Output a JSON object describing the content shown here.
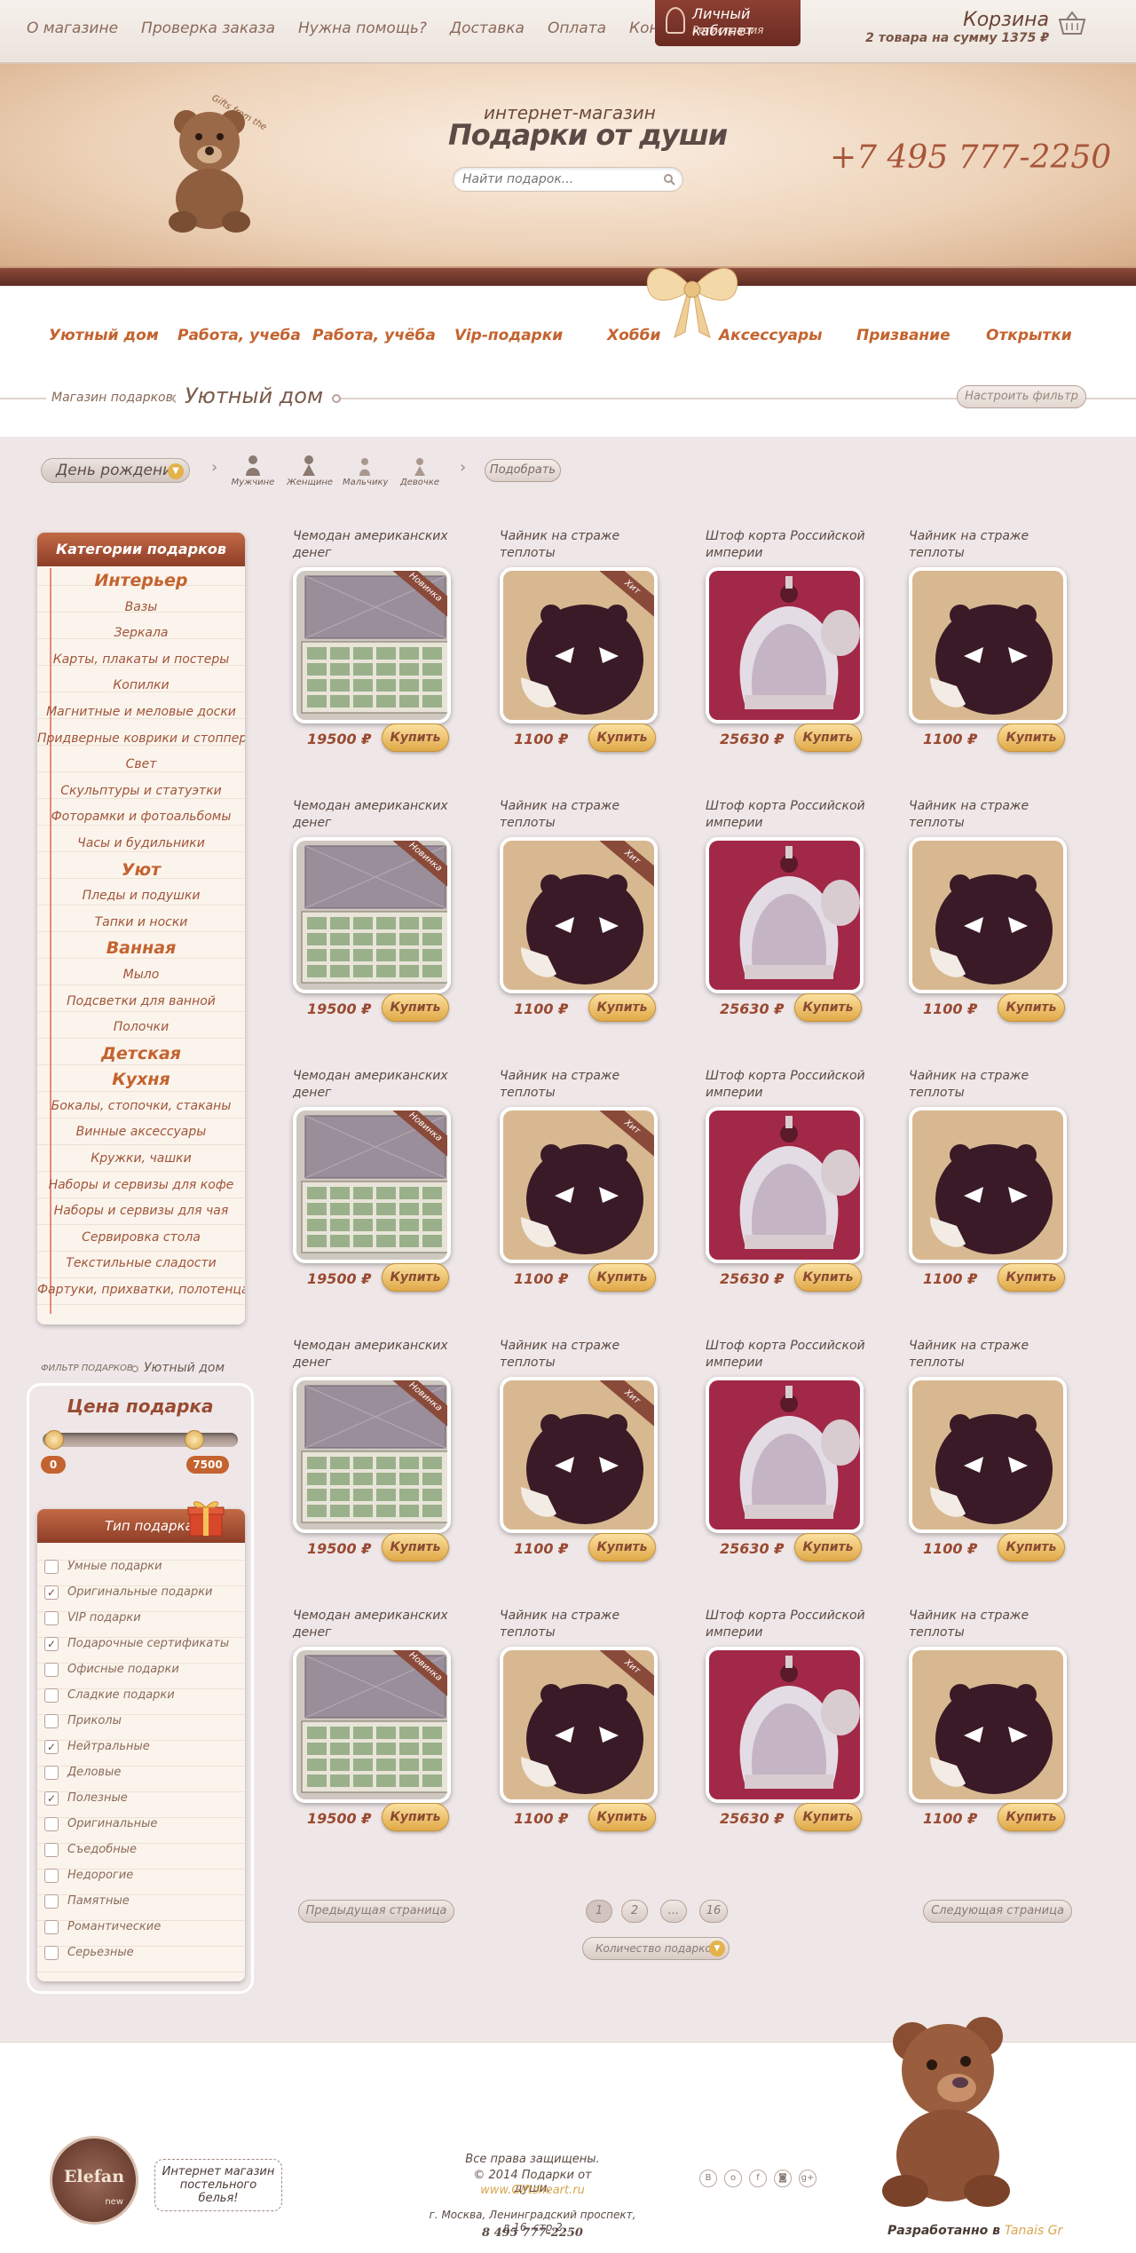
{
  "top_nav": [
    "О магазине",
    "Проверка заказа",
    "Нужна помощь?",
    "Доставка",
    "Оплата",
    "Контакты"
  ],
  "cabinet": {
    "title": "Личный кабинет",
    "sub": "Регистрация"
  },
  "cart": {
    "title": "Корзина",
    "summary": "2 товара на сумму 1375 ₽"
  },
  "header": {
    "logo_text": "Gifts from the heart",
    "subtitle": "интернет-магазин",
    "title": "Подарки от души",
    "search_placeholder": "Найти подарок...",
    "phone": "+7 495 777-2250"
  },
  "categories": [
    "Уютный дом",
    "Работа, учеба",
    "Работа, учёба",
    "Vip-подарки",
    "Хобби",
    "Аксессуары",
    "Призвание",
    "Открытки"
  ],
  "breadcrumb": {
    "root": "Магазин подарков",
    "current": "Уютный дом"
  },
  "filter_button": "Настроить фильтр",
  "occasion": "День рождение",
  "recipients": [
    "Мужчине",
    "Женщине",
    "Мальчику",
    "Девочке"
  ],
  "pick_button": "Подобрать",
  "sidebar": {
    "header": "Категории подарков",
    "items": [
      {
        "label": "Интерьер",
        "big": true
      },
      {
        "label": "Вазы"
      },
      {
        "label": "Зеркала"
      },
      {
        "label": "Карты, плакаты и постеры"
      },
      {
        "label": "Копилки"
      },
      {
        "label": "Магнитные и меловые доски"
      },
      {
        "label": "Придверные коврики и стопперы"
      },
      {
        "label": "Свет"
      },
      {
        "label": "Скульптуры и статуэтки"
      },
      {
        "label": "Фоторамки и фотоальбомы"
      },
      {
        "label": "Часы и будильники"
      },
      {
        "label": "Уют",
        "big": true
      },
      {
        "label": "Пледы и подушки"
      },
      {
        "label": "Тапки и носки"
      },
      {
        "label": "Ванная",
        "big": true
      },
      {
        "label": "Мыло"
      },
      {
        "label": "Подсветки для ванной"
      },
      {
        "label": "Полочки"
      },
      {
        "label": "Детская",
        "big": true
      },
      {
        "label": "Кухня",
        "big": true
      },
      {
        "label": "Бокалы, стопочки, стаканы"
      },
      {
        "label": "Винные аксессуары"
      },
      {
        "label": "Кружки, чашки"
      },
      {
        "label": "Наборы и сервизы для кофе"
      },
      {
        "label": "Наборы и сервизы для чая"
      },
      {
        "label": "Сервировка стола"
      },
      {
        "label": "Текстильные сладости"
      },
      {
        "label": "Фартуки, прихватки, полотенца"
      }
    ]
  },
  "filter": {
    "label": "ФИЛЬТР ПОДАРКОВ",
    "current": "Уютный дом",
    "price_title": "Цена подарка",
    "price_min": "0",
    "price_max": "7500",
    "type_title": "Тип подарка",
    "types": [
      {
        "label": "Умные подарки",
        "checked": false
      },
      {
        "label": "Оригинальные подарки",
        "checked": true
      },
      {
        "label": "VIP подарки",
        "checked": false
      },
      {
        "label": "Подарочные сертификаты",
        "checked": true
      },
      {
        "label": "Офисные подарки",
        "checked": false
      },
      {
        "label": "Сладкие подарки",
        "checked": false
      },
      {
        "label": "Приколы",
        "checked": false
      },
      {
        "label": "Нейтральные",
        "checked": true
      },
      {
        "label": "Деловые",
        "checked": false
      },
      {
        "label": "Полезные",
        "checked": true
      },
      {
        "label": "Оригинальные",
        "checked": false
      },
      {
        "label": "Съедобные",
        "checked": false
      },
      {
        "label": "Недорогие",
        "checked": false
      },
      {
        "label": "Памятные",
        "checked": false
      },
      {
        "label": "Романтические",
        "checked": false
      },
      {
        "label": "Серьезные",
        "checked": false
      }
    ]
  },
  "product_template": [
    {
      "name": "Чемодан американских денег",
      "price": "19500 ₽",
      "tag": "Новинка",
      "kind": "case"
    },
    {
      "name": "Чайник на страже теплоты",
      "price": "1100 ₽",
      "tag": "Хит",
      "kind": "teapot"
    },
    {
      "name": "Штоф корта Российской империи",
      "price": "25630 ₽",
      "tag": "",
      "kind": "crown"
    },
    {
      "name": "Чайник на страже теплоты",
      "price": "1100 ₽",
      "tag": "",
      "kind": "teapot2"
    }
  ],
  "buy_label": "Купить",
  "pagination": {
    "prev": "Предыдущая страница",
    "next": "Следующая страница",
    "pages": [
      "1",
      "2",
      "...",
      "16"
    ],
    "count": "Количество подарков"
  },
  "footer": {
    "partner_logo": "Elefan",
    "partner_logo_sub": "new",
    "partner_text": "Интернет магазин постельного белья!",
    "rights": "Все права защищены.",
    "copyright": "© 2014 Подарки от души.",
    "site": "www.Giftsheart.ru",
    "address": "г. Москва, Ленинградский проспект, д.16, стр.2",
    "phone": "8 495 777-2250",
    "social": [
      "В",
      "о",
      "f",
      "◙",
      "g+"
    ],
    "dev_label": "Разработанно в",
    "dev_name": "Tanais Gr"
  },
  "colors": {
    "accent": "#c4632f",
    "brown": "#8e3d28",
    "gold": "#e0a948",
    "bg": "#efe7e7"
  }
}
